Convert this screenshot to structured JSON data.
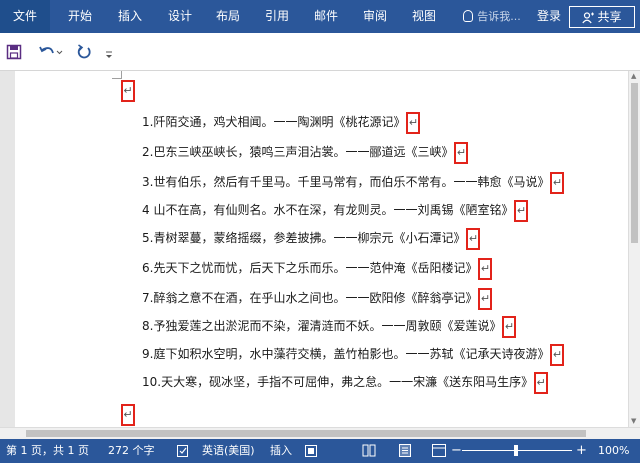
{
  "ribbon": {
    "tabs": [
      "文件",
      "开始",
      "插入",
      "设计",
      "布局",
      "引用",
      "邮件",
      "审阅",
      "视图"
    ],
    "tell_me": "告诉我...",
    "login": "登录",
    "share": "共享"
  },
  "document": {
    "pilcrow": "↵",
    "lines": [
      "1.阡陌交通，鸡犬相闻。一一陶渊明《桃花源记》",
      "2.巴东三峡巫峡长，猿鸣三声泪沾裳。一一郦道远《三峡》",
      "3.世有伯乐，然后有千里马。千里马常有，而伯乐不常有。一一韩愈《马说》",
      "4 山不在高，有仙则名。水不在深，有龙则灵。一一刘禹锡《陋室铭》",
      "5.青树翠蔓，蒙络摇缀，参差披拂。一一柳宗元《小石潭记》",
      "6.先天下之忧而忧，后天下之乐而乐。一一范仲淹《岳阳楼记》",
      "7.醉翁之意不在酒，在乎山水之间也。一一欧阳修《醉翁亭记》",
      "8.予独爱莲之出淤泥而不染，濯清涟而不妖。一一周敦颐《爱莲说》",
      "9.庭下如积水空明，水中藻荇交横，盖竹柏影也。一一苏轼《记承天诗夜游》",
      "10.天大寒，砚冰坚，手指不可屈伸，弗之怠。一一宋濂《送东阳马生序》"
    ]
  },
  "status": {
    "page": "第 1 页，共 1 页",
    "words": "272 个字",
    "language": "英语(美国)",
    "mode": "插入",
    "zoom": "100%"
  },
  "colors": {
    "ribbon": "#2b579a",
    "pilcrow_highlight": "#e2231a"
  }
}
